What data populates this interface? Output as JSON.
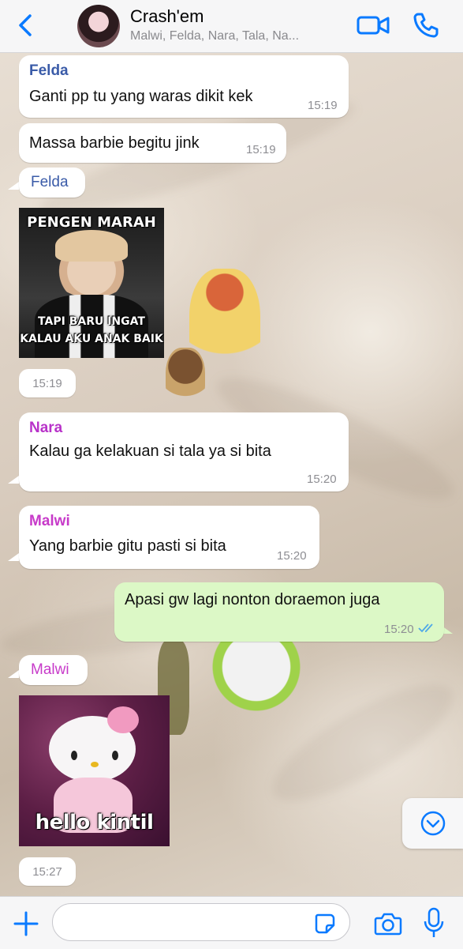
{
  "header": {
    "title": "Crash'em",
    "subtitle": "Malwi, Felda, Nara, Tala, Na...",
    "icons": [
      "back-chevron-icon",
      "video-camera-icon",
      "phone-icon"
    ]
  },
  "colors": {
    "accent": "#0a7aff",
    "felda": "#3a5ba8",
    "nara": "#b832c9",
    "malwi": "#c73ac9",
    "outgoing_bubble": "#dcf8c6",
    "read_ticks": "#4fa8e8"
  },
  "messages": [
    {
      "sender": "Felda",
      "text": "Ganti pp tu yang waras dikit kek",
      "time": "15:19"
    },
    {
      "text": "Massa barbie begitu jink",
      "time": "15:19"
    },
    {
      "sender": "Felda"
    },
    {
      "image": "meme-photo",
      "caption_top": "PENGEN MARAH",
      "caption_bottom_1": "TAPI BARU INGAT",
      "caption_bottom_2": "KALAU AKU ANAK BAIK",
      "time": "15:19"
    },
    {
      "sender": "Nara",
      "text": "Kalau ga kelakuan si tala ya si bita",
      "time": "15:20"
    },
    {
      "sender": "Malwi",
      "text": "Yang barbie gitu pasti si bita",
      "time": "15:20"
    },
    {
      "outgoing": true,
      "text": "Apasi gw lagi nonton doraemon juga",
      "time": "15:20",
      "status": "read"
    },
    {
      "sender": "Malwi"
    },
    {
      "image": "hello-kitty-photo",
      "caption": "hello kintil",
      "time": "15:27"
    }
  ],
  "input": {
    "placeholder": "",
    "value": ""
  }
}
